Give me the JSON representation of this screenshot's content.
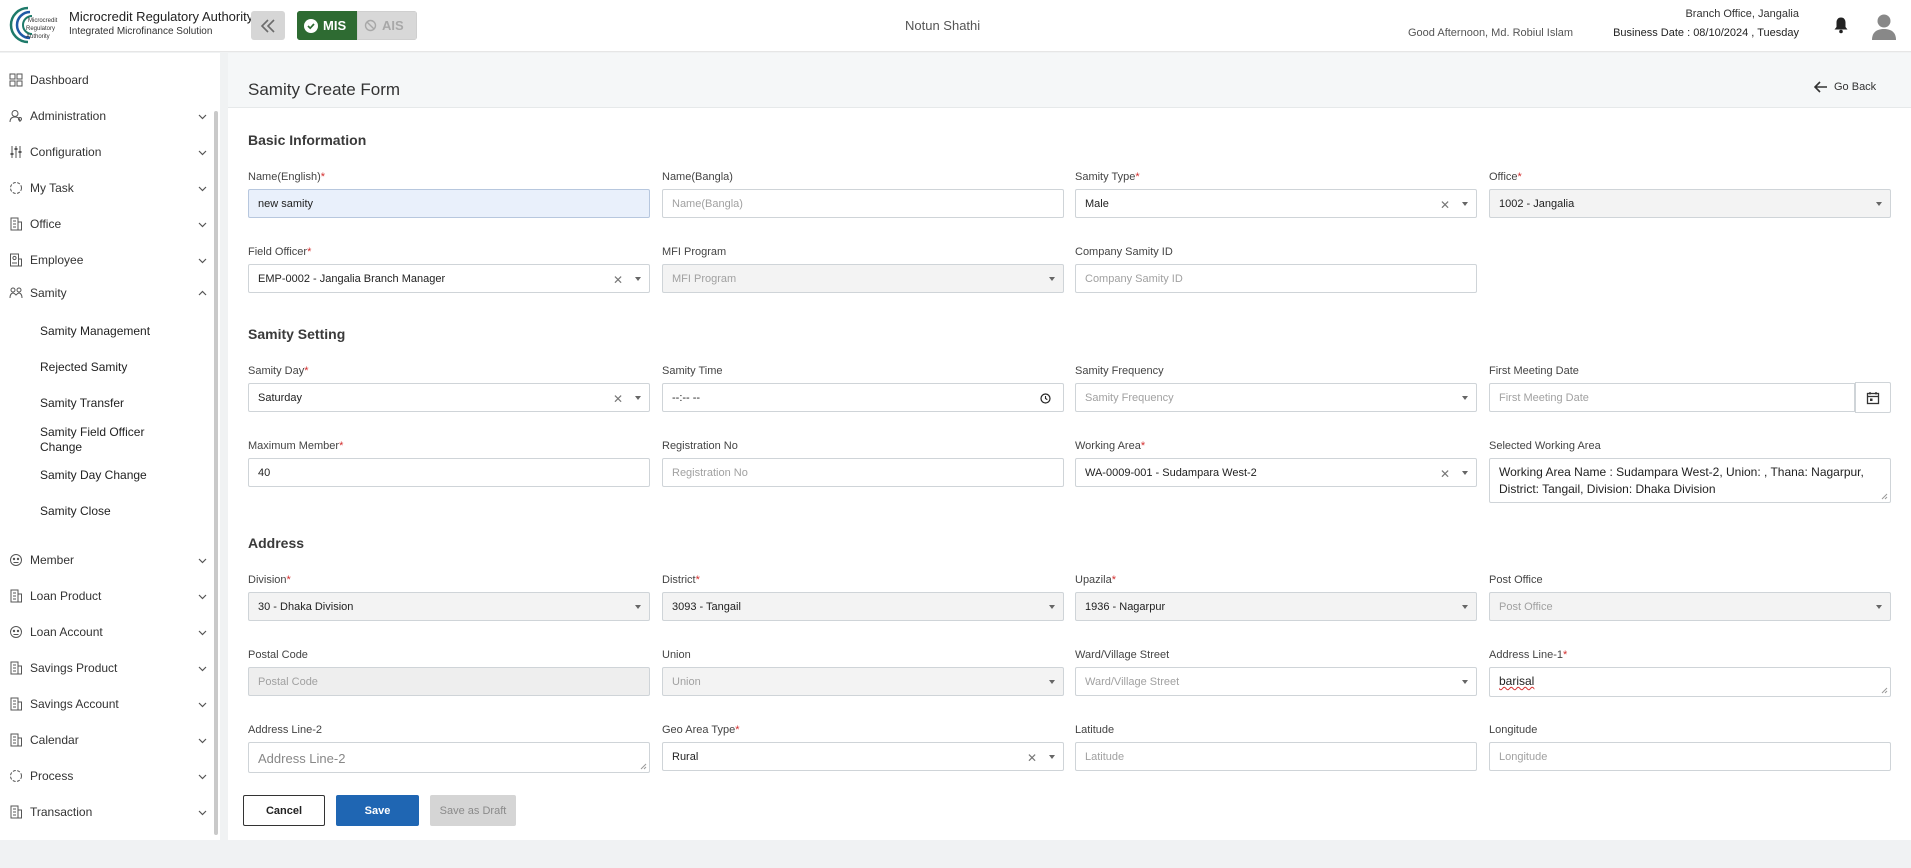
{
  "header": {
    "brand_title": "Microcredit Regulatory Authority",
    "brand_subtitle": "Integrated Microfinance Solution",
    "logo_text_1": "Microcredit",
    "logo_text_2": "Regulatory",
    "logo_text_3": "Authority",
    "mode_mis": "MIS",
    "mode_ais": "AIS",
    "app_name": "Notun Shathi",
    "greeting": "Good Afternoon, Md. Robiul Islam",
    "branch": "Branch Office, Jangalia",
    "business_date": "Business Date : 08/10/2024 , Tuesday"
  },
  "sidebar": {
    "items": [
      {
        "label": "Dashboard",
        "icon": "dashboard-icon"
      },
      {
        "label": "Administration",
        "icon": "admin-icon"
      },
      {
        "label": "Configuration",
        "icon": "configuration-icon"
      },
      {
        "label": "My Task",
        "icon": "task-icon"
      },
      {
        "label": "Office",
        "icon": "office-icon"
      },
      {
        "label": "Employee",
        "icon": "employee-icon"
      },
      {
        "label": "Samity",
        "icon": "samity-icon",
        "expanded": true
      }
    ],
    "sub_items": [
      "Samity Management",
      "Rejected Samity",
      "Samity Transfer",
      "Samity Field Officer Change",
      "Samity Day Change",
      "Samity Close"
    ],
    "items_after": [
      {
        "label": "Member",
        "icon": "member-icon"
      },
      {
        "label": "Loan Product",
        "icon": "loan-product-icon"
      },
      {
        "label": "Loan Account",
        "icon": "loan-account-icon"
      },
      {
        "label": "Savings Product",
        "icon": "savings-product-icon"
      },
      {
        "label": "Savings Account",
        "icon": "savings-account-icon"
      },
      {
        "label": "Calendar",
        "icon": "calendar-icon"
      },
      {
        "label": "Process",
        "icon": "process-icon"
      },
      {
        "label": "Transaction",
        "icon": "transaction-icon"
      }
    ]
  },
  "page": {
    "title": "Samity Create Form",
    "go_back": "Go Back"
  },
  "sections": {
    "basic": "Basic Information",
    "setting": "Samity Setting",
    "address": "Address"
  },
  "form": {
    "name_en": {
      "label": "Name(English)",
      "value": "new samity"
    },
    "name_bn": {
      "label": "Name(Bangla)",
      "placeholder": "Name(Bangla)"
    },
    "samity_type": {
      "label": "Samity Type",
      "value": "Male"
    },
    "office": {
      "label": "Office",
      "value": "1002 - Jangalia"
    },
    "field_officer": {
      "label": "Field Officer",
      "value": "EMP-0002 - Jangalia Branch Manager"
    },
    "mfi_program": {
      "label": "MFI Program",
      "placeholder": "MFI Program"
    },
    "company_samity_id": {
      "label": "Company Samity ID",
      "placeholder": "Company Samity ID"
    },
    "samity_day": {
      "label": "Samity Day",
      "value": "Saturday"
    },
    "samity_time": {
      "label": "Samity Time",
      "value": "--:-- --"
    },
    "samity_frequency": {
      "label": "Samity Frequency",
      "placeholder": "Samity Frequency"
    },
    "first_meeting_date": {
      "label": "First Meeting Date",
      "placeholder": "First Meeting Date"
    },
    "maximum_member": {
      "label": "Maximum Member",
      "value": "40"
    },
    "registration_no": {
      "label": "Registration No",
      "placeholder": "Registration No"
    },
    "working_area": {
      "label": "Working Area",
      "value": "WA-0009-001 - Sudampara West-2"
    },
    "selected_working_area": {
      "label": "Selected Working Area",
      "line1": "Working Area Name : Sudampara West-2, Union: , Thana:  Nagarpur,",
      "line2": "District: Tangail, Division: Dhaka Division"
    },
    "division": {
      "label": "Division",
      "value": "30 - Dhaka Division"
    },
    "district": {
      "label": "District",
      "value": "3093 - Tangail"
    },
    "upazila": {
      "label": "Upazila",
      "value": "1936 - Nagarpur"
    },
    "post_office": {
      "label": "Post Office",
      "placeholder": "Post Office"
    },
    "postal_code": {
      "label": "Postal Code",
      "placeholder": "Postal Code"
    },
    "union": {
      "label": "Union",
      "placeholder": "Union"
    },
    "ward": {
      "label": "Ward/Village Street",
      "placeholder": "Ward/Village Street"
    },
    "address_line_1": {
      "label": "Address Line-1",
      "value": "barisal"
    },
    "address_line_2": {
      "label": "Address Line-2",
      "placeholder": "Address Line-2"
    },
    "geo_area_type": {
      "label": "Geo Area Type",
      "value": "Rural"
    },
    "latitude": {
      "label": "Latitude",
      "placeholder": "Latitude"
    },
    "longitude": {
      "label": "Longitude",
      "placeholder": "Longitude"
    }
  },
  "footer": {
    "cancel": "Cancel",
    "save": "Save",
    "save_draft": "Save as Draft"
  },
  "colors": {
    "accent": "#1f66b3",
    "mis_active": "#2e6b32",
    "required": "#d32f2f"
  }
}
